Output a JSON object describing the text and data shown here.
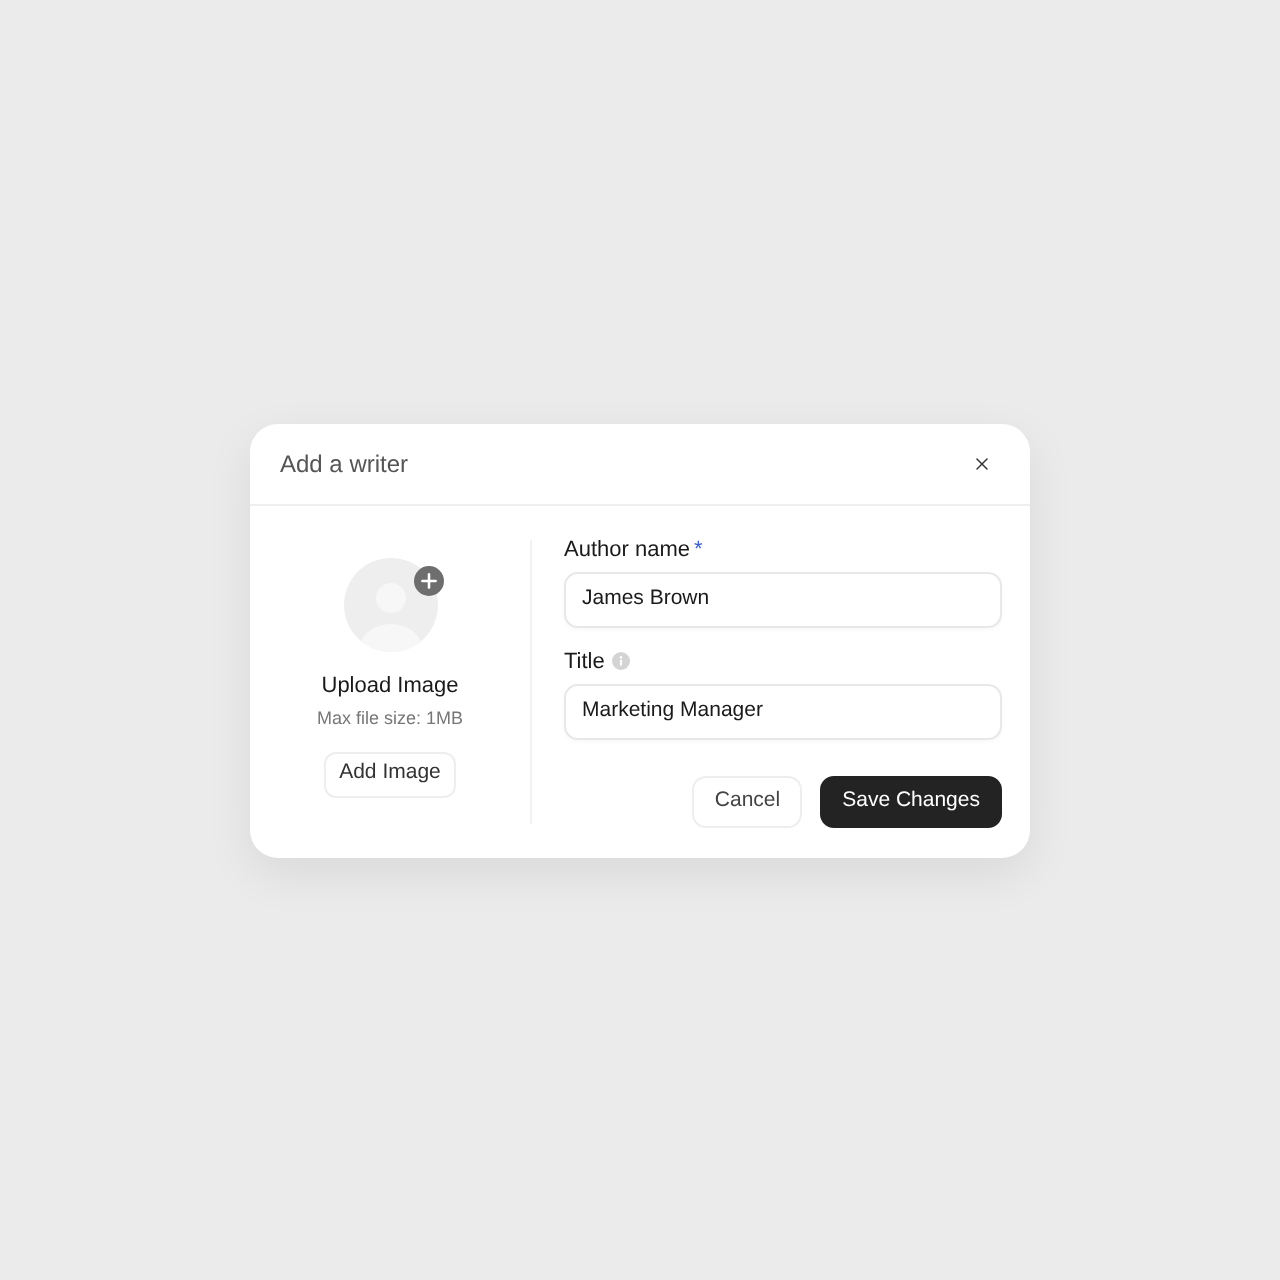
{
  "dialog": {
    "title": "Add a writer"
  },
  "upload": {
    "label": "Upload Image",
    "hint": "Max file size: 1MB",
    "button": "Add Image"
  },
  "fields": [
    {
      "label": "Author name",
      "required_mark": "*",
      "info": false,
      "value": "James Brown"
    },
    {
      "label": "Title",
      "info": true,
      "value": "Marketing Manager"
    }
  ],
  "buttons": [
    {
      "label": "Cancel",
      "kind": "secondary"
    },
    {
      "label": "Save Changes",
      "kind": "primary"
    }
  ]
}
